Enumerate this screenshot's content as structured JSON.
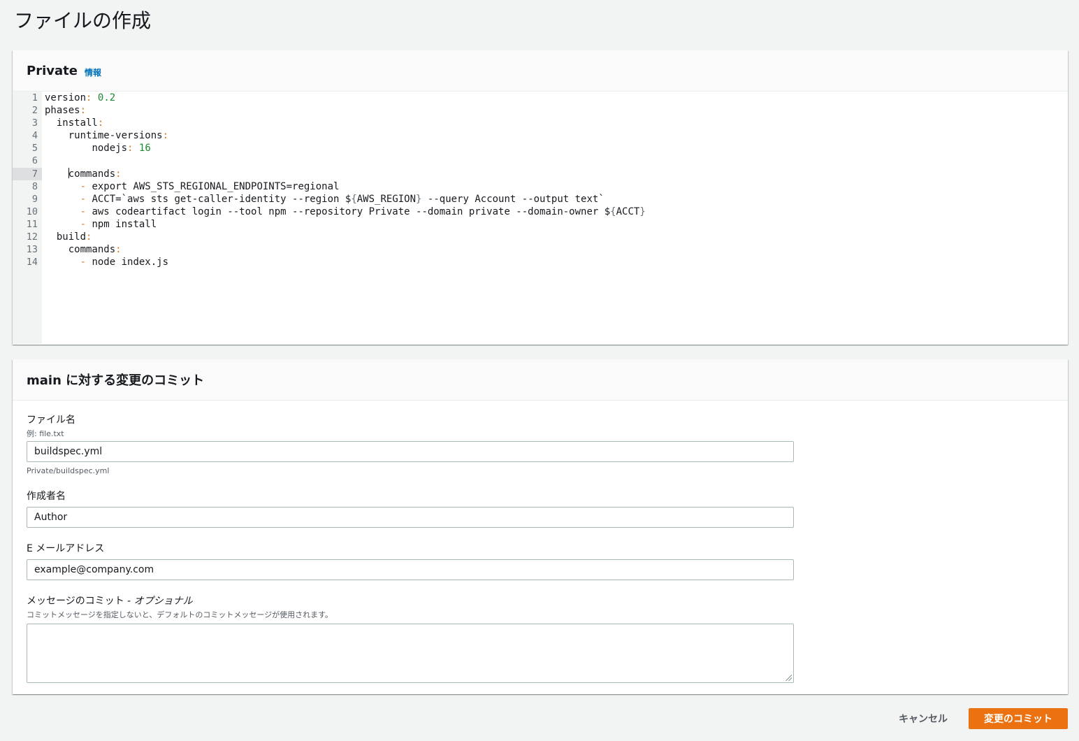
{
  "page": {
    "title": "ファイルの作成"
  },
  "editor_panel": {
    "title": "Private",
    "info_link": "情報",
    "active_line": 7,
    "lines": [
      {
        "n": "1",
        "segs": [
          [
            "key",
            "version"
          ],
          [
            "punc",
            ":"
          ],
          [
            "txt",
            " "
          ],
          [
            "num",
            "0.2"
          ]
        ]
      },
      {
        "n": "2",
        "segs": [
          [
            "key",
            "phases"
          ],
          [
            "punc",
            ":"
          ]
        ]
      },
      {
        "n": "3",
        "segs": [
          [
            "txt",
            "  "
          ],
          [
            "key",
            "install"
          ],
          [
            "punc",
            ":"
          ]
        ]
      },
      {
        "n": "4",
        "segs": [
          [
            "txt",
            "    "
          ],
          [
            "key",
            "runtime-versions"
          ],
          [
            "punc",
            ":"
          ]
        ]
      },
      {
        "n": "5",
        "segs": [
          [
            "txt",
            "        "
          ],
          [
            "key",
            "nodejs"
          ],
          [
            "punc",
            ":"
          ],
          [
            "txt",
            " "
          ],
          [
            "num",
            "16"
          ]
        ]
      },
      {
        "n": "6",
        "segs": []
      },
      {
        "n": "7",
        "segs": [
          [
            "txt",
            "    "
          ],
          [
            "cursor",
            ""
          ],
          [
            "key",
            "commands"
          ],
          [
            "punc",
            ":"
          ]
        ]
      },
      {
        "n": "8",
        "segs": [
          [
            "txt",
            "      "
          ],
          [
            "dash",
            "-"
          ],
          [
            "txt",
            " export AWS_STS_REGIONAL_ENDPOINTS=regional"
          ]
        ]
      },
      {
        "n": "9",
        "segs": [
          [
            "txt",
            "      "
          ],
          [
            "dash",
            "-"
          ],
          [
            "txt",
            " ACCT=`aws sts get-caller-identity --region $"
          ],
          [
            "brace",
            "{"
          ],
          [
            "txt",
            "AWS_REGION"
          ],
          [
            "brace",
            "}"
          ],
          [
            "txt",
            " --query Account --output text`"
          ]
        ]
      },
      {
        "n": "10",
        "segs": [
          [
            "txt",
            "      "
          ],
          [
            "dash",
            "-"
          ],
          [
            "txt",
            " aws codeartifact login --tool npm --repository Private --domain private --domain-owner $"
          ],
          [
            "brace",
            "{"
          ],
          [
            "txt",
            "ACCT"
          ],
          [
            "brace",
            "}"
          ]
        ]
      },
      {
        "n": "11",
        "segs": [
          [
            "txt",
            "      "
          ],
          [
            "dash",
            "-"
          ],
          [
            "txt",
            " npm install"
          ]
        ]
      },
      {
        "n": "12",
        "segs": [
          [
            "txt",
            "  "
          ],
          [
            "key",
            "build"
          ],
          [
            "punc",
            ":"
          ]
        ]
      },
      {
        "n": "13",
        "segs": [
          [
            "txt",
            "    "
          ],
          [
            "key",
            "commands"
          ],
          [
            "punc",
            ":"
          ]
        ]
      },
      {
        "n": "14",
        "segs": [
          [
            "txt",
            "      "
          ],
          [
            "dash",
            "-"
          ],
          [
            "txt",
            " node index.js"
          ]
        ]
      }
    ]
  },
  "commit_panel": {
    "title": "main に対する変更のコミット",
    "file_name": {
      "label": "ファイル名",
      "description": "例: file.txt",
      "value": "buildspec.yml",
      "path_hint": "Private/buildspec.yml"
    },
    "author": {
      "label": "作成者名",
      "value": "Author"
    },
    "email": {
      "label": "E メールアドレス",
      "value": "example@company.com"
    },
    "message": {
      "label": "メッセージのコミット - ",
      "label_optional": "オプショナル",
      "description": "コミットメッセージを指定しないと、デフォルトのコミットメッセージが使用されます。",
      "value": ""
    }
  },
  "actions": {
    "cancel": "キャンセル",
    "commit": "変更のコミット"
  },
  "colors": {
    "primary": "#ec7211",
    "link": "#0073bb",
    "background": "#f2f3f3"
  }
}
